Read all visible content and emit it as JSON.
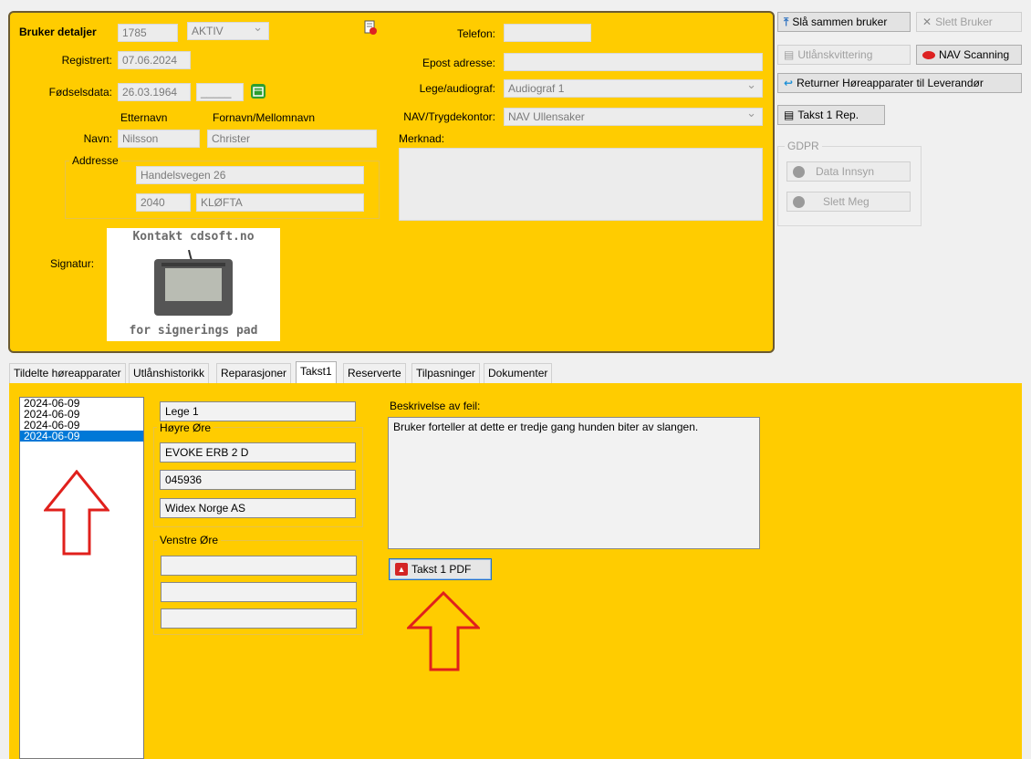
{
  "details": {
    "title": "Bruker detaljer",
    "id": "1785",
    "status": "AKTIV",
    "registrert_label": "Registrert:",
    "registrert": "07.06.2024",
    "fodselsdata_label": "Fødselsdata:",
    "fodselsdata": "26.03.1964",
    "fodselsdata_extra": "_____",
    "etternavn_label": "Etternavn",
    "fornavn_label": "Fornavn/Mellomnavn",
    "navn_label": "Navn:",
    "etternavn": "Nilsson",
    "fornavn": "Christer",
    "adresse_label": "Addresse",
    "adresse": "Handelsvegen 26",
    "postnr": "2040",
    "poststed": "KLØFTA",
    "signatur_label": "Signatur:",
    "signatur_text_top": "Kontakt cdsoft.no",
    "signatur_text_bottom": "for signerings pad",
    "telefon_label": "Telefon:",
    "telefon": "",
    "epost_label": "Epost adresse:",
    "epost": "",
    "lege_label": "Lege/audiograf:",
    "lege": "Audiograf 1",
    "nav_label": "NAV/Trygdekontor:",
    "nav": "NAV Ullensaker",
    "merknad_label": "Merknad:",
    "merknad": ""
  },
  "actions": {
    "merge": "Slå sammen bruker",
    "delete": "Slett Bruker",
    "loan_receipt": "Utlånskvittering",
    "nav_scanning": "NAV Scanning",
    "return_devices": "Returner Høreapparater til Leverandør",
    "takst_rep": "Takst 1 Rep.",
    "gdpr_title": "GDPR",
    "data_innsyn": "Data Innsyn",
    "slett_meg": "Slett Meg"
  },
  "tabs": [
    {
      "label": "Tildelte høreapparater"
    },
    {
      "label": "Utlånshistorikk"
    },
    {
      "label": "Reparasjoner"
    },
    {
      "label": "Takst1"
    },
    {
      "label": "Reserverte"
    },
    {
      "label": "Tilpasninger"
    },
    {
      "label": "Dokumenter"
    }
  ],
  "takst": {
    "dates": [
      "2024-06-09",
      "2024-06-09",
      "2024-06-09",
      "2024-06-09"
    ],
    "lege": "Lege 1",
    "hoyre_label": "Høyre Øre",
    "hoyre_model": "EVOKE ERB 2 D",
    "hoyre_serial": "045936",
    "hoyre_supplier": "Widex Norge AS",
    "venstre_label": "Venstre Øre",
    "venstre_model": "",
    "venstre_serial": "",
    "venstre_supplier": "",
    "beskrivelse_label": "Beskrivelse av feil:",
    "beskrivelse": "Bruker forteller at dette er tredje gang hunden biter av slangen.",
    "pdf_button": "Takst 1 PDF"
  },
  "colors": {
    "panel": "#ffcc00",
    "selection": "#0078d7",
    "annotation_arrow": "#e0201c"
  }
}
